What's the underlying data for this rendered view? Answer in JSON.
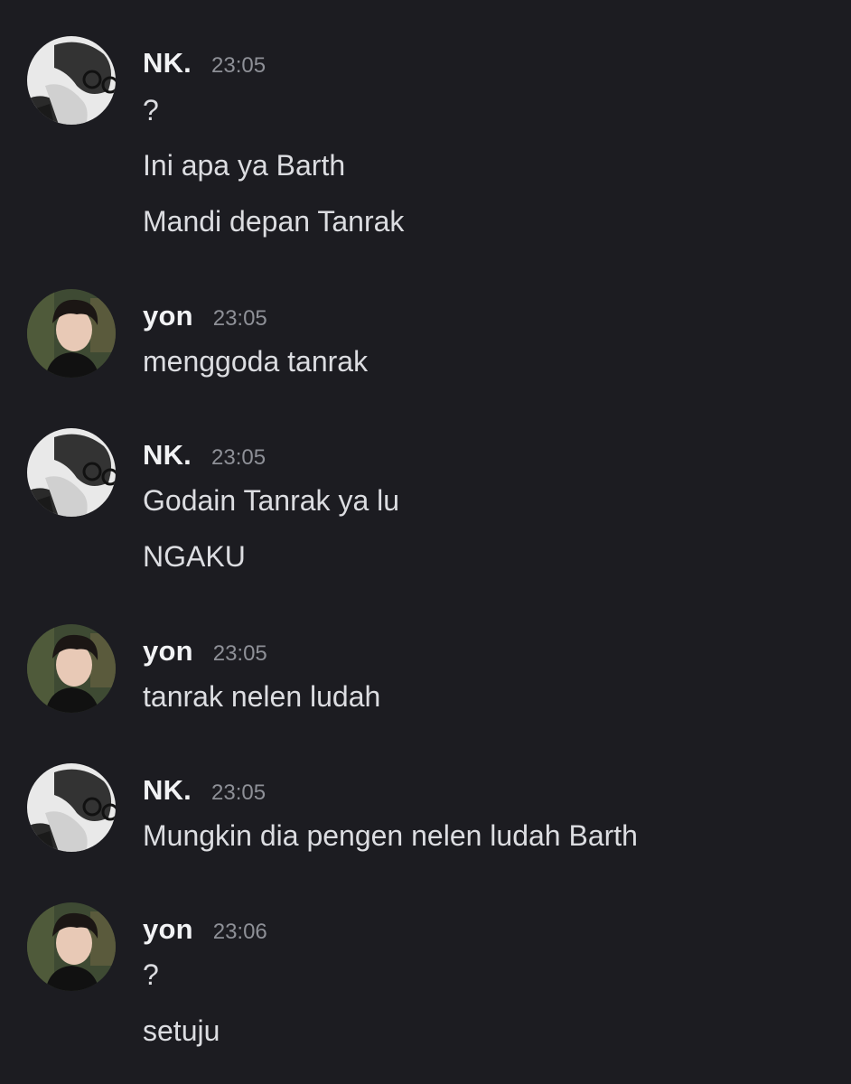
{
  "messages": [
    {
      "author": "NK.",
      "time": "23:05",
      "avatar": "nk-avatar",
      "lines": [
        "?",
        "Ini apa ya Barth",
        "Mandi depan Tanrak"
      ]
    },
    {
      "author": "yon",
      "time": "23:05",
      "avatar": "yon-avatar",
      "lines": [
        "menggoda tanrak"
      ]
    },
    {
      "author": "NK.",
      "time": "23:05",
      "avatar": "nk-avatar",
      "lines": [
        "Godain Tanrak ya lu",
        "NGAKU"
      ]
    },
    {
      "author": "yon",
      "time": "23:05",
      "avatar": "yon-avatar",
      "lines": [
        "tanrak nelen ludah"
      ]
    },
    {
      "author": "NK.",
      "time": "23:05",
      "avatar": "nk-avatar",
      "lines": [
        "Mungkin dia pengen nelen ludah Barth"
      ]
    },
    {
      "author": "yon",
      "time": "23:06",
      "avatar": "yon-avatar",
      "lines": [
        "?",
        "setuju"
      ]
    }
  ],
  "colors": {
    "background": "#1c1c21",
    "username": "#f2f3f5",
    "timestamp": "#8e9097",
    "message_text": "#dcdde1"
  }
}
